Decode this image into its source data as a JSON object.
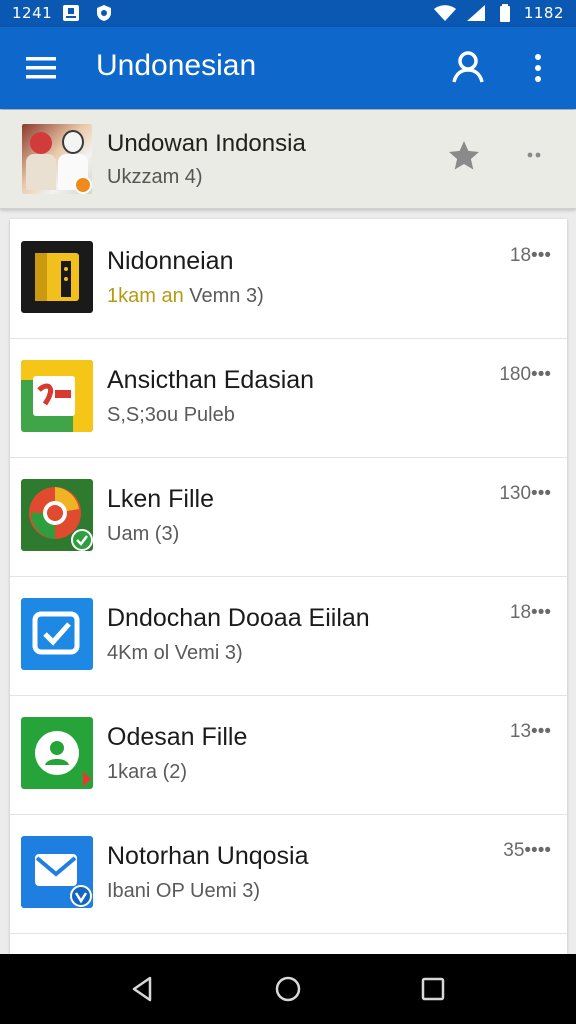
{
  "status_bar": {
    "time_left": "1241",
    "time_right": "1182"
  },
  "app_bar": {
    "title": "Undonesian",
    "menu_icon": "hamburger-menu-icon",
    "account_icon": "account-icon",
    "more_icon": "more-vert-icon",
    "color": "#0e67cb"
  },
  "pinned": {
    "title": "Undowan Indonsia",
    "subtitle": "Ukzzam 4)",
    "star_icon": "star-icon",
    "more_icon": "more-horiz-icon"
  },
  "items": [
    {
      "title": "Nidonneian",
      "subtitle_highlight": "1kam an",
      "subtitle_rest": " Vemn 3)",
      "time": "18•••",
      "icon": "folder-app-icon"
    },
    {
      "title": "Ansicthan Edasian",
      "subtitle_highlight": "",
      "subtitle_rest": "S,S;3ou Puleb",
      "time": "180•••",
      "icon": "shopping-app-icon"
    },
    {
      "title": "Lken Fille",
      "subtitle_highlight": "",
      "subtitle_rest": "Uam (3)",
      "time": "130•••",
      "icon": "chrome-app-icon"
    },
    {
      "title": "Dndochan Dooaa Eiilan",
      "subtitle_highlight": "",
      "subtitle_rest": "4Km ol  Vemi 3)",
      "time": "18•••",
      "icon": "checkbox-app-icon"
    },
    {
      "title": "Odesan Fille",
      "subtitle_highlight": "",
      "subtitle_rest": "1kara (2)",
      "time": "13•••",
      "icon": "contacts-app-icon"
    },
    {
      "title": "Notorhan Unqosia",
      "subtitle_highlight": "",
      "subtitle_rest": "Ibani OP  Uemi 3)",
      "time": "35••••",
      "icon": "mail-app-icon"
    }
  ],
  "nav_bar": {
    "back_icon": "back-icon",
    "home_icon": "home-icon",
    "recents_icon": "recents-icon"
  }
}
